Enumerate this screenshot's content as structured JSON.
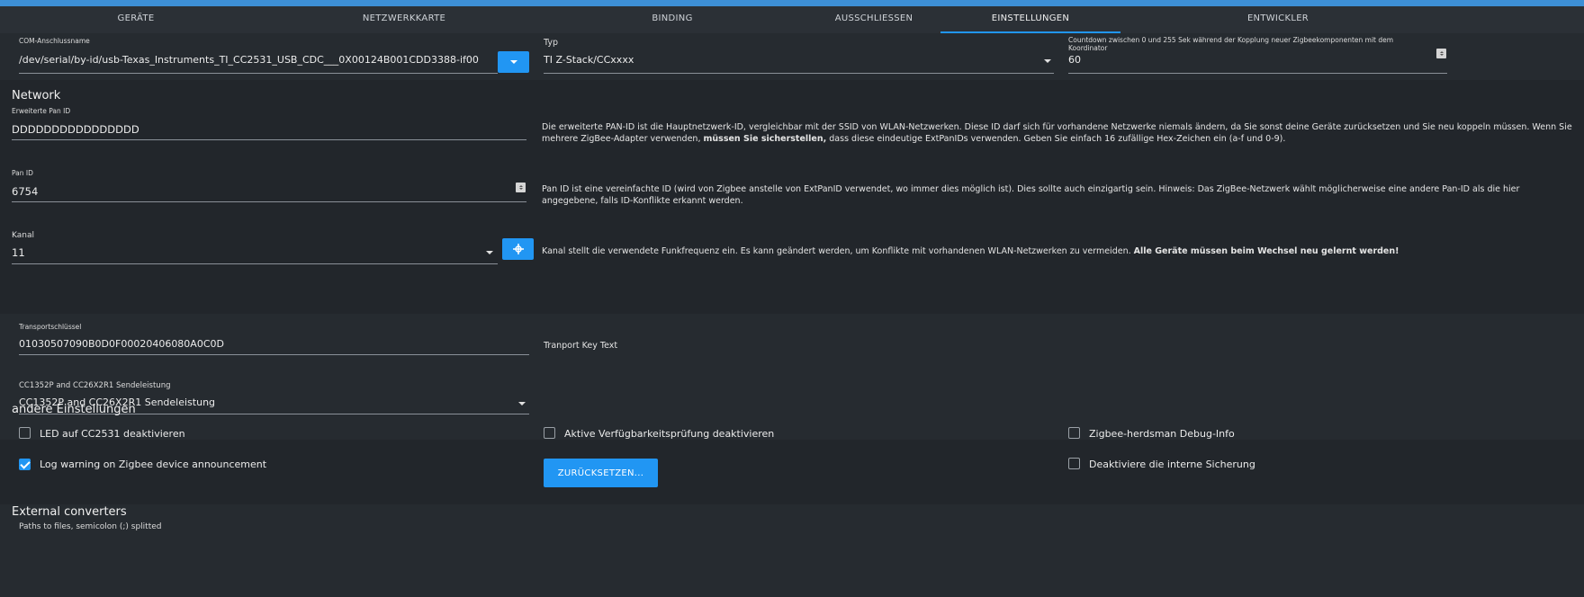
{
  "tabs": [
    {
      "label": "GERÄTE"
    },
    {
      "label": "NETZWERKKARTE"
    },
    {
      "label": "BINDING"
    },
    {
      "label": "AUSSCHLIESSEN"
    },
    {
      "label": "EINSTELLUNGEN"
    },
    {
      "label": "ENTWICKLER"
    }
  ],
  "active_tab": "EINSTELLUNGEN",
  "com": {
    "label": "COM-Anschlussname",
    "value": "/dev/serial/by-id/usb-Texas_Instruments_TI_CC2531_USB_CDC___0X00124B001CDD3388-if00"
  },
  "typ": {
    "label": "Typ",
    "value": "TI Z-Stack/CCxxxx"
  },
  "countdown": {
    "label_line1": "Countdown zwischen 0 und 255 Sek während der Kopplung neuer Zigbeekomponenten mit dem",
    "label_line2": "Koordinator",
    "value": "60"
  },
  "network": {
    "heading": "Network",
    "ext_pan": {
      "label": "Erweiterte Pan ID",
      "value": "DDDDDDDDDDDDDDDD",
      "desc_part1": "Die erweiterte PAN-ID ist die Hauptnetzwerk-ID, vergleichbar mit der SSID von WLAN-Netzwerken. Diese ID darf sich für vorhandene Netzwerke niemals ändern, da Sie sonst deine Geräte zurücksetzen und Sie neu koppeln müssen. Wenn Sie mehrere ZigBee-Adapter verwenden,",
      "desc_bold": "müssen Sie sicherstellen,",
      "desc_part2": "dass diese eindeutige ExtPanIDs verwenden. Geben Sie einfach 16 zufällige Hex-Zeichen ein (a-f und 0-9)."
    },
    "pan": {
      "label": "Pan ID",
      "value": "6754",
      "desc": "Pan ID ist eine vereinfachte ID (wird von Zigbee anstelle von ExtPanID verwendet, wo immer dies möglich ist). Dies sollte auch einzigartig sein. Hinweis: Das ZigBee-Netzwerk wählt möglicherweise eine andere Pan-ID als die hier angegebene, falls ID-Konflikte erkannt werden."
    },
    "kanal": {
      "label": "Kanal",
      "value": "11",
      "desc_part1": "Kanal stellt die verwendete Funkfrequenz ein. Es kann geändert werden, um Konflikte mit vorhandenen WLAN-Netzwerken zu vermeiden.",
      "desc_bold": "Alle Geräte müssen beim Wechsel neu gelernt werden!"
    },
    "transport": {
      "label": "Transportschlüssel",
      "value": "01030507090B0D0F00020406080A0C0D",
      "desc": "Tranport Key Text"
    },
    "power": {
      "label": "CC1352P and CC26X2R1 Sendeleistung",
      "value": "CC1352P and CC26X2R1 Sendeleistung"
    }
  },
  "other": {
    "heading": "andere Einstellungen",
    "checkboxes": [
      {
        "label": "LED auf CC2531 deaktivieren",
        "checked": false
      },
      {
        "label": "Aktive Verfügbarkeitsprüfung deaktivieren",
        "checked": false
      },
      {
        "label": "Zigbee-herdsman Debug-Info",
        "checked": false
      },
      {
        "label": "Log warning on Zigbee device announcement",
        "checked": true
      },
      {
        "label": "Deaktiviere die interne Sicherung",
        "checked": false
      }
    ],
    "reset_label": "ZURÜCKSETZEN..."
  },
  "external": {
    "heading": "External converters",
    "label": "Paths to files, semicolon (;) splitted"
  },
  "colors": {
    "accent": "#2196f3",
    "background": "#22262b",
    "tabbar": "#2b3036"
  }
}
